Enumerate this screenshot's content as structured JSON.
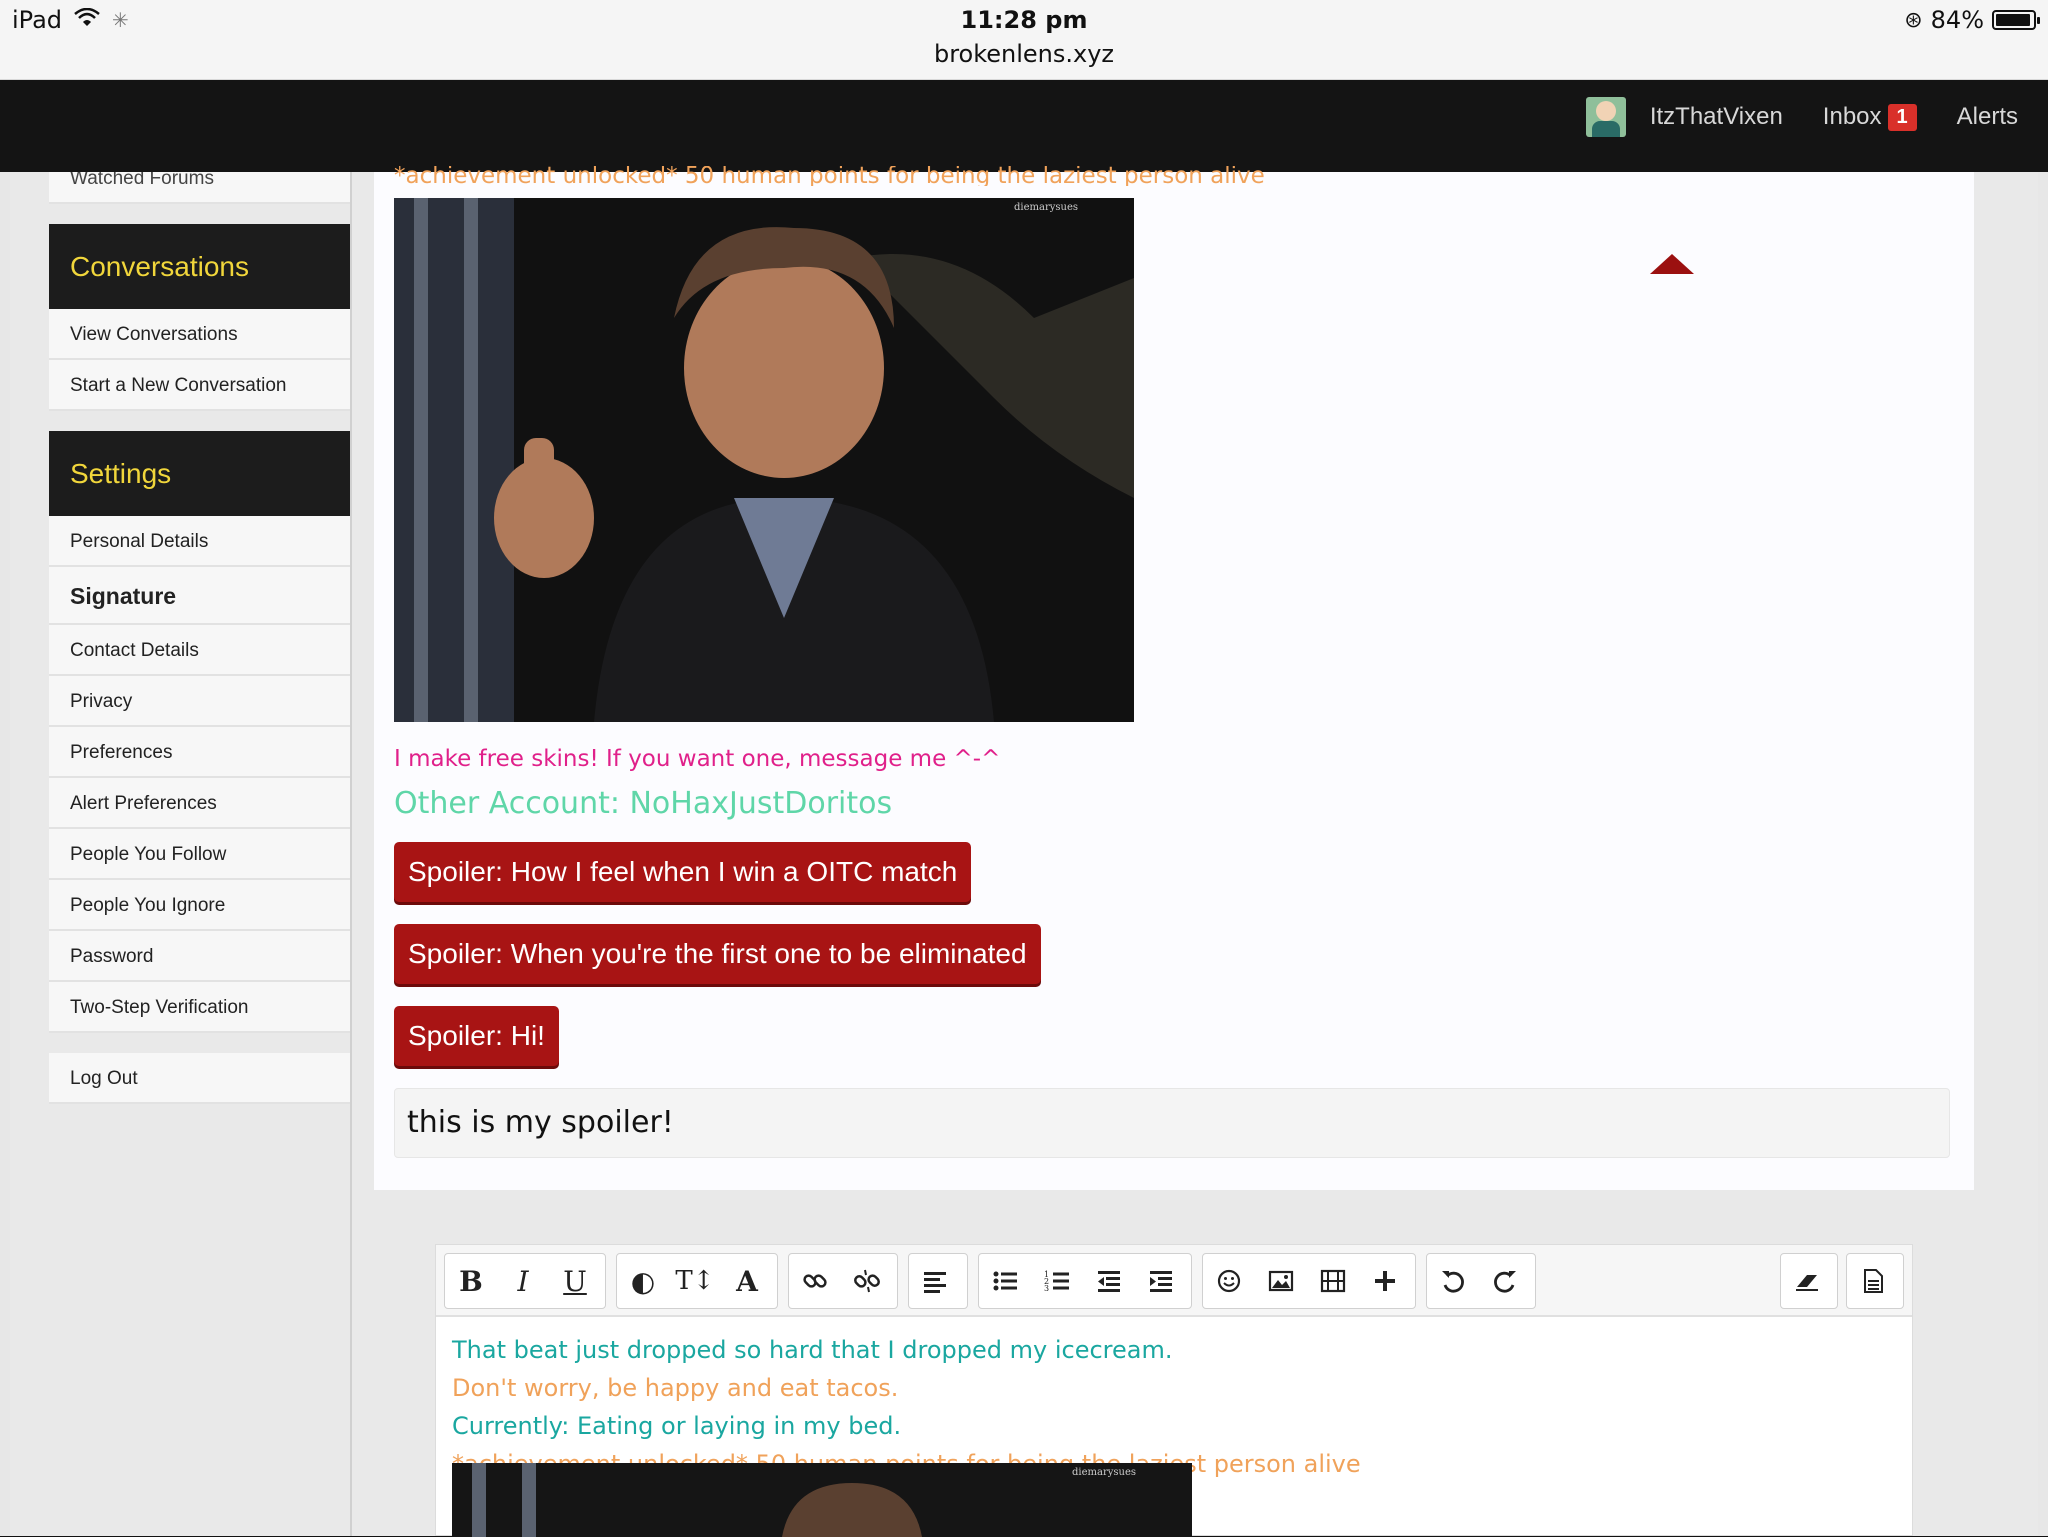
{
  "status_bar": {
    "device": "iPad",
    "time": "11:28 pm",
    "url": "brokenlens.xyz",
    "battery": "84%"
  },
  "nav": {
    "username": "ItzThatVixen",
    "inbox_label": "Inbox",
    "inbox_count": "1",
    "alerts_label": "Alerts"
  },
  "sidebar": {
    "cut_item": "Watched Forums",
    "conversations": {
      "heading": "Conversations",
      "items": [
        "View Conversations",
        "Start a New Conversation"
      ]
    },
    "settings": {
      "heading": "Settings",
      "items": [
        "Personal Details",
        "Signature",
        "Contact Details",
        "Privacy",
        "Preferences",
        "Alert Preferences",
        "People You Follow",
        "People You Ignore",
        "Password",
        "Two-Step Verification"
      ]
    },
    "logout": "Log Out"
  },
  "post": {
    "cut_line": "*achievement unlocked* 50 human points for being the laziest person alive",
    "image_watermark": "diemarysues",
    "sig_line1": "I make free skins! If you want one, message me ^-^",
    "sig_line2": "Other Account: NoHaxJustDoritos",
    "spoilers": [
      "Spoiler: How I feel when I win a OITC match",
      "Spoiler: When you're the first one to be eliminated",
      "Spoiler: Hi!"
    ],
    "spoiler_content": "this is my spoiler!"
  },
  "editor": {
    "toolbar_icons": [
      "bold-icon",
      "italic-icon",
      "underline-icon",
      "text-color-icon",
      "font-size-icon",
      "font-family-icon",
      "link-icon",
      "unlink-icon",
      "align-icon",
      "bullet-list-icon",
      "numbered-list-icon",
      "outdent-icon",
      "indent-icon",
      "smilie-icon",
      "image-icon",
      "media-icon",
      "insert-more-icon",
      "undo-icon",
      "redo-icon",
      "remove-formatting-icon",
      "toggle-bbcode-icon"
    ],
    "lines": [
      {
        "text": "That beat just dropped so hard that I dropped my icecream.",
        "color": "#1aa7a0"
      },
      {
        "text": "Don't worry, be happy and eat tacos.",
        "color": "#f0a25a"
      },
      {
        "text": "Currently: Eating or laying in my bed.",
        "color": "#1aa7a0"
      },
      {
        "text": "*achievement unlocked* 50 human points for being the laziest person alive",
        "color": "#f0a25a"
      }
    ],
    "image_watermark": "diemarysues"
  }
}
